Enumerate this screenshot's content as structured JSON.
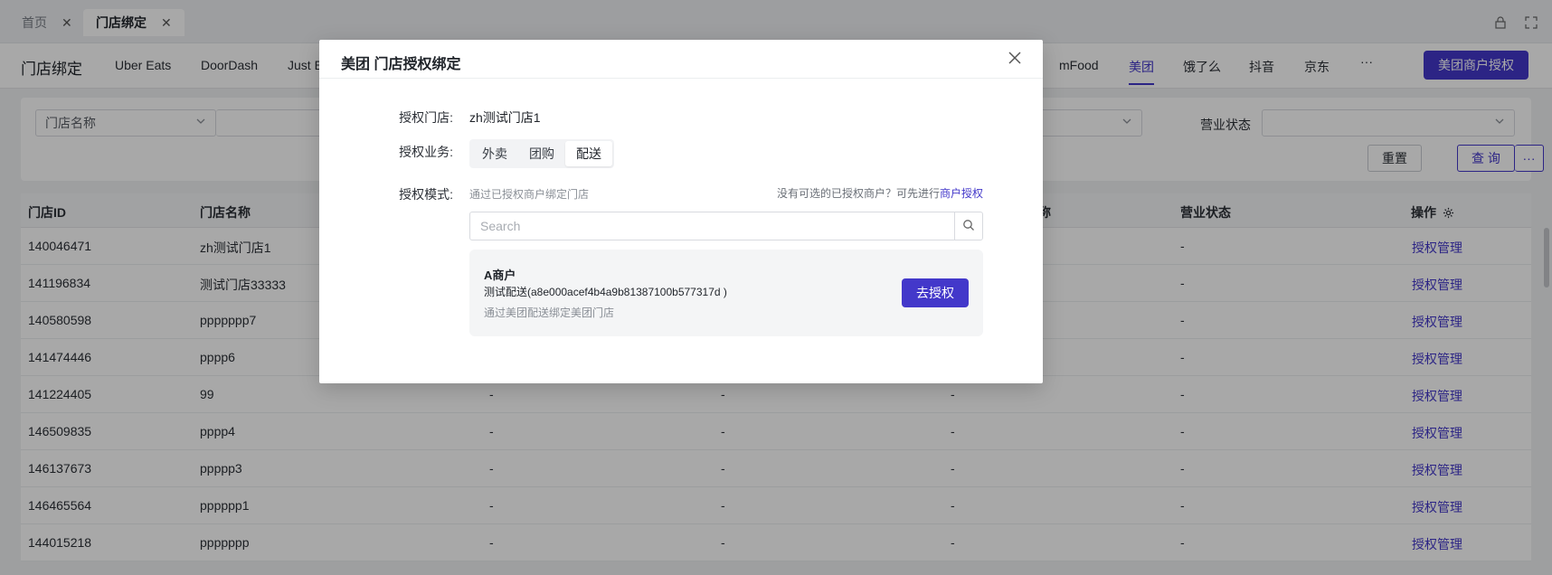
{
  "tabs": [
    {
      "label": "首页",
      "active": false
    },
    {
      "label": "门店绑定",
      "active": true
    }
  ],
  "nav": {
    "title": "门店绑定",
    "items": [
      "Uber Eats",
      "DoorDash",
      "Just E",
      "mFood",
      "美团",
      "饿了么",
      "抖音",
      "京东",
      "···"
    ],
    "active": "美团",
    "auth_button": "美团商户授权"
  },
  "filter": {
    "field_select": "门店名称",
    "status_label": "营业状态",
    "reset": "重置",
    "query": "查 询",
    "more": "···"
  },
  "table": {
    "headers": {
      "id": "门店ID",
      "name": "门店名称",
      "col5": "称",
      "status": "营业状态",
      "action": "操作"
    },
    "rows": [
      {
        "id": "140046471",
        "name": "zh测试门店1",
        "c3": "",
        "c4": "",
        "c5": "",
        "status": "-",
        "action": "授权管理"
      },
      {
        "id": "141196834",
        "name": "测试门店33333",
        "c3": "",
        "c4": "",
        "c5": "",
        "status": "-",
        "action": "授权管理"
      },
      {
        "id": "140580598",
        "name": "ppppppp7",
        "c3": "",
        "c4": "",
        "c5": "",
        "status": "-",
        "action": "授权管理"
      },
      {
        "id": "141474446",
        "name": "pppp6",
        "c3": "",
        "c4": "",
        "c5": "",
        "status": "-",
        "action": "授权管理"
      },
      {
        "id": "141224405",
        "name": "99",
        "c3": "-",
        "c4": "-",
        "c5": "-",
        "status": "-",
        "action": "授权管理"
      },
      {
        "id": "146509835",
        "name": "pppp4",
        "c3": "-",
        "c4": "-",
        "c5": "-",
        "status": "-",
        "action": "授权管理"
      },
      {
        "id": "146137673",
        "name": "ppppp3",
        "c3": "-",
        "c4": "-",
        "c5": "-",
        "status": "-",
        "action": "授权管理"
      },
      {
        "id": "146465564",
        "name": "pppppp1",
        "c3": "-",
        "c4": "-",
        "c5": "-",
        "status": "-",
        "action": "授权管理"
      },
      {
        "id": "144015218",
        "name": "ppppppp",
        "c3": "-",
        "c4": "-",
        "c5": "-",
        "status": "-",
        "action": "授权管理"
      }
    ]
  },
  "modal": {
    "title": "美团 门店授权绑定",
    "store_label": "授权门店:",
    "store_value": "zh测试门店1",
    "business_label": "授权业务:",
    "business_options": [
      "外卖",
      "团购",
      "配送"
    ],
    "business_active": "配送",
    "mode_label": "授权模式:",
    "mode_hint": "通过已授权商户绑定门店",
    "no_merchant_hint": "没有可选的已授权商户？可先进行",
    "merchant_auth_link": "商户授权",
    "search_placeholder": "Search",
    "merchant": {
      "name": "A商户",
      "detail": "测试配送(a8e000acef4b4a9b81387100b577317d )",
      "desc": "通过美团配送绑定美团门店",
      "button": "去授权"
    }
  },
  "colors": {
    "accent": "#4338ca"
  }
}
